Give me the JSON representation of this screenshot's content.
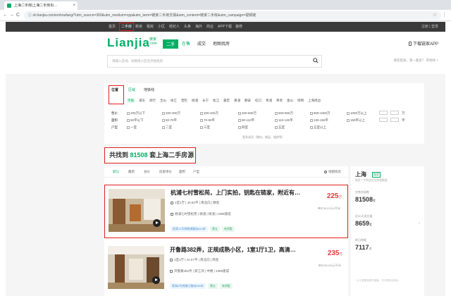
{
  "browser": {
    "tab_title": "上海二手房|上海二手房出…",
    "tab_close": "×",
    "url": "sh.lianjia.com/ershoufang/?utm_source=360&utm_medium=cpp&utm_term=链家二手房交易&utm_content=链家二手房&utm_campaign=视频链",
    "back": "←",
    "forward": "→",
    "reload": "C",
    "info": "ⓘ",
    "star": "☆",
    "menu": "⋮"
  },
  "topnav": {
    "items": [
      "首页",
      "二手房",
      "新房",
      "租房",
      "小区",
      "经纪人",
      "头条",
      "海外",
      "商业",
      "APP下载",
      "装修"
    ],
    "active_index": 1,
    "right": "注册 | 登录"
  },
  "header": {
    "logo": "Lianjia",
    "logo_sub": "链家 .com",
    "categories": [
      "二手",
      "在售",
      "成交",
      "地图找房"
    ],
    "app_link": "下载链家APP",
    "search_placeholder": "请输入区域、商圈或小区名开始找房",
    "header_links": "请先登录，第一套房？ 开始找 >"
  },
  "filter": {
    "tabs": [
      "位置",
      "地铁线"
    ],
    "sub_tabs": [
      "区域"
    ],
    "districts": [
      "不限",
      "浦东",
      "闵行",
      "宝山",
      "徐汇",
      "普陀",
      "杨浦",
      "长宁",
      "松江",
      "嘉定",
      "黄浦",
      "静安",
      "虹口",
      "青浦",
      "奉贤",
      "金山",
      "崇明",
      "上海周边"
    ],
    "rows": [
      {
        "label": "售价",
        "options": [
          "200万以下",
          "200-300万",
          "300-400万",
          "400-500万",
          "500-800万",
          "800-1000万",
          "1000万以上"
        ],
        "unit": "万"
      },
      {
        "label": "面积",
        "options": [
          "50平以下",
          "50-70平",
          "70-90平",
          "90-110平",
          "110-130平",
          "130-150平",
          "150平以上"
        ],
        "unit": "平"
      },
      {
        "label": "户型",
        "options": [
          "一室",
          "二室",
          "三室",
          "四室",
          "五室",
          "五室以上"
        ],
        "unit": ""
      }
    ],
    "note": "更多选项（朝向、楼层、楼龄等）"
  },
  "results": {
    "prefix": "共找到",
    "count": "81508",
    "suffix": "套上海二手房源"
  },
  "sortbar": {
    "items": [
      "默认",
      "最新",
      "总价",
      "房屋单价",
      "面积",
      "户型"
    ],
    "map_search": "地图找房"
  },
  "listings": [
    {
      "title": "杭浦七村雪松苑，上门实拍，钥匙在链家，附近有…",
      "info": "1室1厅 | 40.82平 | 南北向 | 精装",
      "location": "杨浦七村雪松苑 | 杨浦 | 杨浦 | 1999建成",
      "tags": [
        "距离11号线杨浦路站810米",
        "满五",
        "有钥匙"
      ],
      "price": "225",
      "price_unit": "万",
      "unit_price": "单价55120元/平米"
    },
    {
      "title": "开鲁路382弄，正规成熟小区，1室1厅1卫，高清…",
      "info": "1室1厅 | 42.57平 | 南北向 | 简装",
      "location": "开鲁路382弄 | 新江湾 | 中楼 | 1989建成",
      "tags": [
        "距离8号线嫩江路站590米",
        "满五",
        "有钥匙"
      ],
      "price": "235",
      "price_unit": "万",
      "unit_price": "单价55193元/平米"
    }
  ],
  "side": {
    "city": "上海",
    "city_tag": "链家",
    "sub": "链家二手房成交及房源数据",
    "stats": [
      {
        "label": "在售房源数",
        "value": "81508",
        "unit": "套"
      },
      {
        "label": "近90天成交量",
        "value": "8659",
        "unit": "套"
      },
      {
        "label": "昨日带看",
        "value": "7117",
        "unit": "次"
      }
    ],
    "foot": "* 以上数据来源于链家，不代表真实房价"
  },
  "colors": {
    "brand_green": "#00ae66",
    "highlight_red": "#e02020",
    "price_red": "#e4393c"
  }
}
